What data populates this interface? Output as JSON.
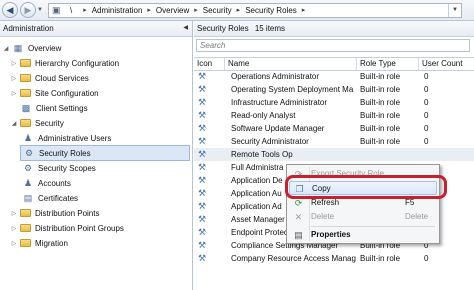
{
  "address": {
    "back_icon": "back-arrow-icon",
    "forward_icon": "forward-arrow-icon",
    "path": [
      "\\",
      "Administration",
      "Overview",
      "Security",
      "Security Roles"
    ]
  },
  "left_panel": {
    "title": "Administration",
    "tree": [
      {
        "label": "Overview",
        "icon": "overview-icon",
        "level": 0,
        "expanded": true
      },
      {
        "label": "Hierarchy Configuration",
        "icon": "folder-icon",
        "level": 1
      },
      {
        "label": "Cloud Services",
        "icon": "folder-icon",
        "level": 1
      },
      {
        "label": "Site Configuration",
        "icon": "folder-icon",
        "level": 1
      },
      {
        "label": "Client Settings",
        "icon": "client-settings-icon",
        "level": 1
      },
      {
        "label": "Security",
        "icon": "folder-icon",
        "level": 1,
        "expanded": true
      },
      {
        "label": "Administrative Users",
        "icon": "users-icon",
        "level": 2
      },
      {
        "label": "Security Roles",
        "icon": "security-roles-icon",
        "level": 2,
        "selected": true
      },
      {
        "label": "Security Scopes",
        "icon": "security-scopes-icon",
        "level": 2
      },
      {
        "label": "Accounts",
        "icon": "accounts-icon",
        "level": 2
      },
      {
        "label": "Certificates",
        "icon": "certificates-icon",
        "level": 2
      },
      {
        "label": "Distribution Points",
        "icon": "folder-icon",
        "level": 1
      },
      {
        "label": "Distribution Point Groups",
        "icon": "folder-icon",
        "level": 1
      },
      {
        "label": "Migration",
        "icon": "folder-icon",
        "level": 1
      }
    ]
  },
  "right_panel": {
    "title": "Security Roles",
    "count": "15 items",
    "search_placeholder": "Search",
    "columns": {
      "icon": "Icon",
      "name": "Name",
      "type": "Role Type",
      "users": "User Count"
    },
    "rows": [
      {
        "name": "Operations Administrator",
        "type": "Built-in role",
        "users": "0"
      },
      {
        "name": "Operating System Deployment Ma",
        "type": "Built-in role",
        "users": "0"
      },
      {
        "name": "Infrastructure Administrator",
        "type": "Built-in role",
        "users": "0"
      },
      {
        "name": "Read-only Analyst",
        "type": "Built-in role",
        "users": "0"
      },
      {
        "name": "Software Update Manager",
        "type": "Built-in role",
        "users": "0"
      },
      {
        "name": "Security Administrator",
        "type": "Built-in role",
        "users": "0"
      },
      {
        "name": "Remote Tools Op",
        "type": "",
        "users": ""
      },
      {
        "name": "Full Administra",
        "type": "",
        "users": ""
      },
      {
        "name": "Application De",
        "type": "",
        "users": ""
      },
      {
        "name": "Application Au",
        "type": "",
        "users": ""
      },
      {
        "name": "Application Ad",
        "type": "",
        "users": ""
      },
      {
        "name": "Asset Manager",
        "type": "",
        "users": ""
      },
      {
        "name": "Endpoint Protection Manager",
        "type": "Built-in role",
        "users": "0"
      },
      {
        "name": "Compliance Settings Manager",
        "type": "Built-in role",
        "users": "0"
      },
      {
        "name": "Company Resource Access Manag",
        "type": "Built-in role",
        "users": "0"
      }
    ]
  },
  "context_menu": {
    "items": [
      {
        "label": "Export Security Role",
        "icon": "export-icon",
        "disabled": true,
        "shortcut": ""
      },
      {
        "label": "Copy",
        "icon": "copy-icon",
        "disabled": false,
        "shortcut": "",
        "highlighted": true
      },
      {
        "label": "Refresh",
        "icon": "refresh-icon",
        "disabled": false,
        "shortcut": "F5"
      },
      {
        "label": "Delete",
        "icon": "delete-icon",
        "disabled": true,
        "shortcut": "Delete"
      },
      {
        "label": "Properties",
        "icon": "properties-icon",
        "disabled": false,
        "shortcut": "",
        "bold": true
      }
    ],
    "annotation_color": "#c8202c"
  },
  "colors": {
    "selection": "#dce7f5",
    "folder": "#e9bd48",
    "accent": "#4d77a8"
  }
}
